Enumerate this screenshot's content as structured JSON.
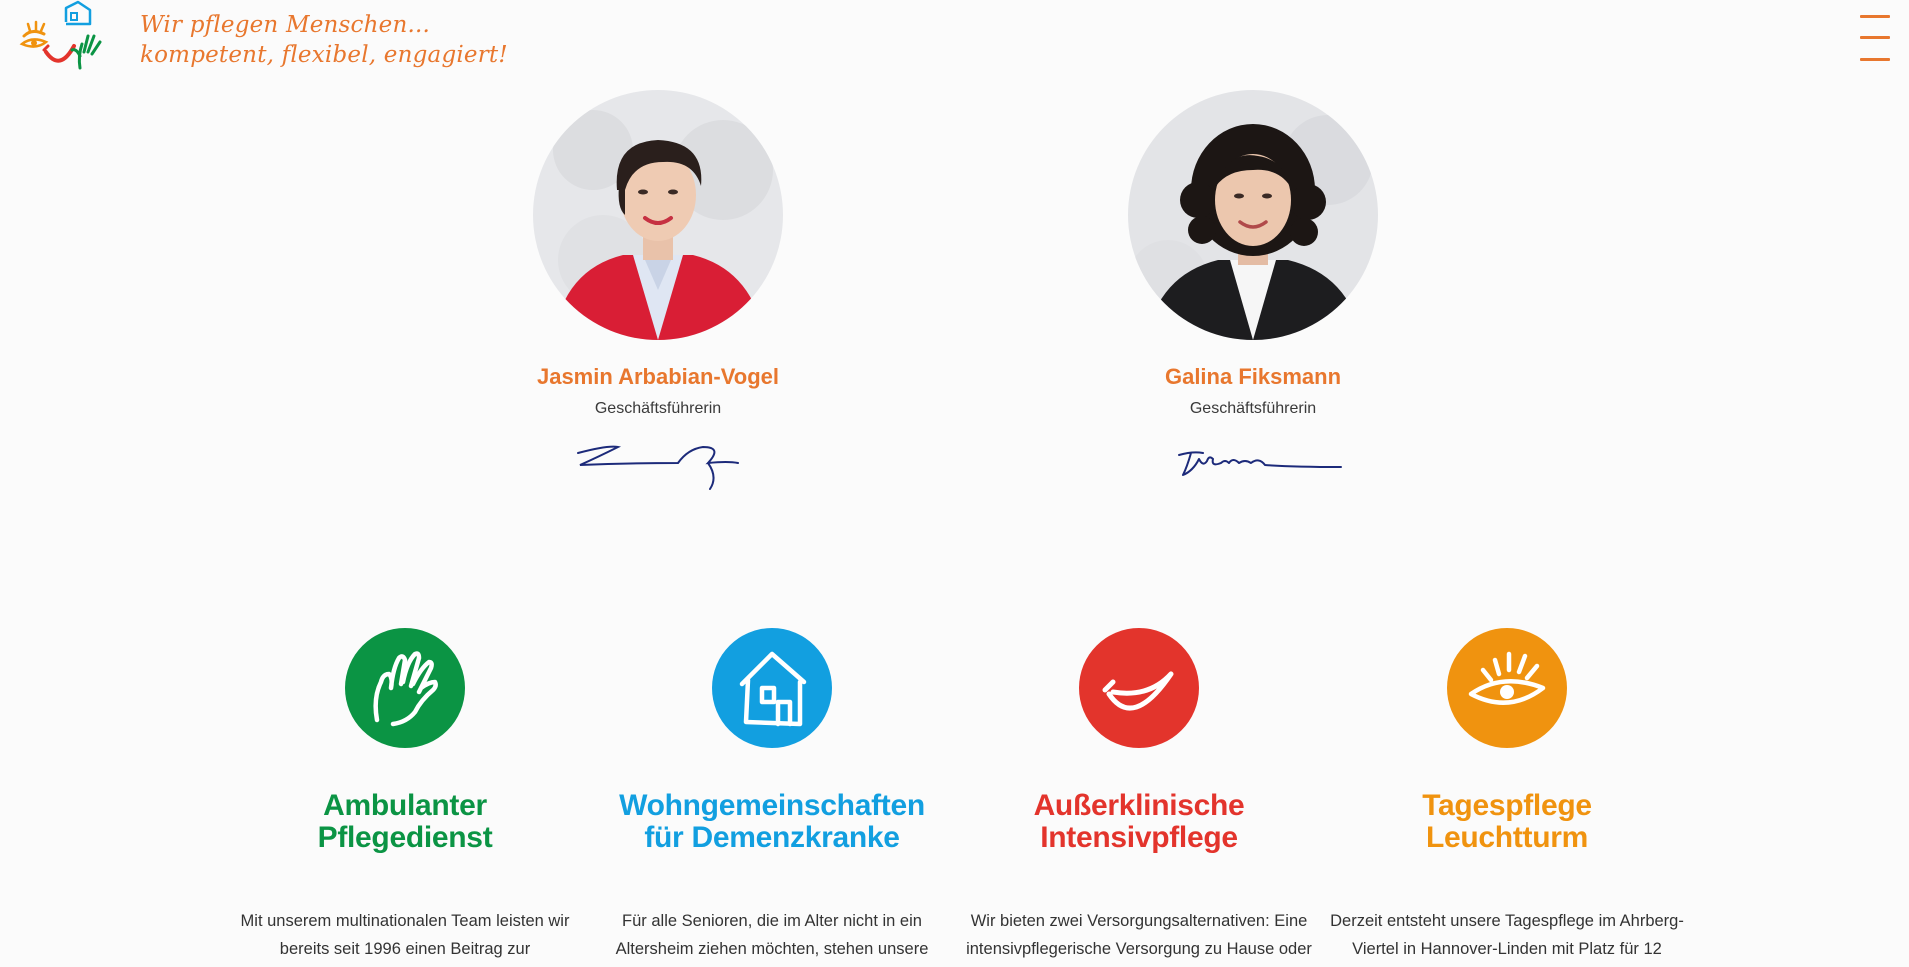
{
  "header": {
    "tagline_line1": "Wir pflegen Menschen...",
    "tagline_line2": "kompetent, flexibel, engagiert!",
    "logo_icon": "care-logo-icon",
    "menu_icon": "hamburger-menu-icon",
    "accent_color": "#e8772e"
  },
  "managers": [
    {
      "name": "Jasmin Arbabian-Vogel",
      "role": "Geschäftsführerin"
    },
    {
      "name": "Galina Fiksmann",
      "role": "Geschäftsführerin"
    }
  ],
  "services": [
    {
      "title_line1": "Ambulanter",
      "title_line2": "Pflegedienst",
      "text_line1": "Mit unserem multinationalen Team leisten wir",
      "text_line2": "bereits seit 1996 einen Beitrag zur",
      "color": "#0b9444",
      "icon": "hand-icon"
    },
    {
      "title_line1": "Wohngemeinschaften",
      "title_line2": "für Demenzkranke",
      "text_line1": "Für alle Senioren, die im Alter nicht in ein",
      "text_line2": "Altersheim ziehen möchten, stehen unsere",
      "color": "#129fe0",
      "icon": "house-icon"
    },
    {
      "title_line1": "Außerklinische",
      "title_line2": "Intensivpflege",
      "text_line1": "Wir bieten zwei Versorgungsalternativen: Eine",
      "text_line2": "intensivpflegerische Versorgung zu Hause oder",
      "color": "#e3342c",
      "icon": "smile-icon"
    },
    {
      "title_line1": "Tagespflege",
      "title_line2": "Leuchtturm",
      "text_line1": "Derzeit entsteht unsere Tagespflege im Ahrberg-",
      "text_line2": "Viertel in Hannover-Linden mit Platz für 12",
      "color": "#f0930f",
      "icon": "eye-icon"
    }
  ]
}
